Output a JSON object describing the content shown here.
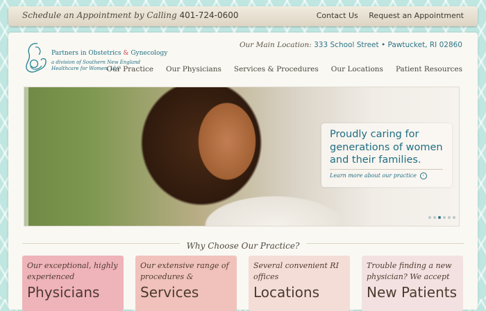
{
  "topbar": {
    "schedule_text": "Schedule an Appointment by Calling",
    "phone": "401-724-0600",
    "links": [
      "Contact Us",
      "Request an Appointment"
    ]
  },
  "logo": {
    "title_part1": "Partners in Obstetrics",
    "title_amp": "&",
    "title_part2": "Gynecology",
    "subtitle": "a division of Southern New England Healthcare for Women, LLC"
  },
  "location": {
    "label": "Our Main Location:",
    "address": "333 School Street • Pawtucket, RI 02860"
  },
  "nav": {
    "items": [
      "Our Practice",
      "Our Physicians",
      "Services & Procedures",
      "Our Locations",
      "Patient Resources"
    ]
  },
  "hero": {
    "headline": "Proudly caring for generations of women and their families.",
    "link": "Learn more about our practice",
    "slides": 6,
    "active_slide": 3
  },
  "why": {
    "heading": "Why Choose Our Practice?"
  },
  "features": [
    {
      "desc": "Our exceptional, highly experienced",
      "title": "Physicians",
      "color": "#efb3ba"
    },
    {
      "desc": "Our extensive range of procedures &",
      "title": "Services",
      "color": "#f0c2bb"
    },
    {
      "desc": "Several convenient RI offices",
      "title": "Locations",
      "color": "#f4ddd6"
    },
    {
      "desc": "Trouble finding a new physician? We accept",
      "title": "New Patients",
      "color": "#f3e1e2"
    }
  ],
  "colors": {
    "brand_teal": "#1e6f83",
    "accent_red": "#d04a52",
    "background": "#bfe6e0"
  }
}
